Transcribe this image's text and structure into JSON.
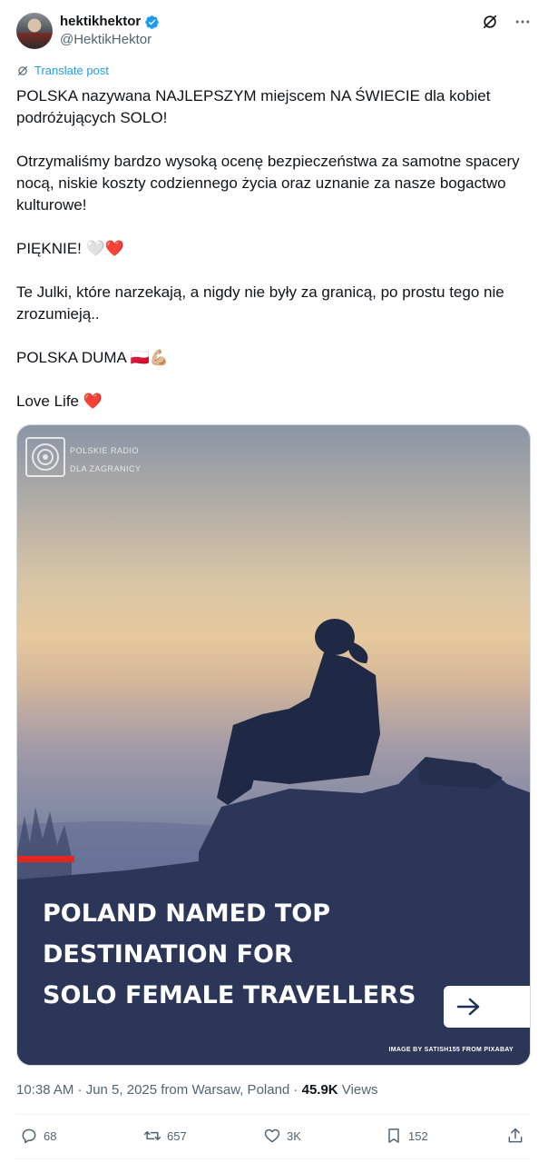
{
  "author": {
    "display_name": "hektikhektor",
    "handle": "@HektikHektor",
    "verified": true
  },
  "header_icons": [
    "grok-icon",
    "more-icon"
  ],
  "translate_label": "Translate post",
  "tweet": {
    "paragraphs": [
      "POLSKA nazywana NAJLEPSZYM miejscem NA ŚWIECIE dla kobiet podróżujących SOLO!",
      "Otrzymaliśmy bardzo wysoką ocenę bezpieczeństwa za samotne spacery nocą, niskie koszty codziennego życia oraz uznanie za nasze bogactwo kulturowe!",
      "PIĘKNIE! 🤍❤️",
      "Te Julki, które narzekają, a nigdy nie były za granicą, po prostu tego nie zrozumieją..",
      "POLSKA DUMA 🇵🇱💪🏼",
      "Love Life ❤️"
    ]
  },
  "media": {
    "logo_line1": "POLSKIE RADIO",
    "logo_line2": "DLA ZAGRANICY",
    "headline_line1": "POLAND NAMED TOP DESTINATION FOR",
    "headline_line2": "SOLO FEMALE TRAVELLERS",
    "credit": "IMAGE BY SATISH155 FROM PIXABAY",
    "accent_color": "#e3261f"
  },
  "meta": {
    "time_date_place": "10:38 AM · Jun 5, 2025 from Warsaw, Poland · ",
    "views_count": "45.9K",
    "views_label": " Views"
  },
  "actions": {
    "replies": "68",
    "reposts": "657",
    "likes": "3K",
    "bookmarks": "152"
  },
  "colors": {
    "link_blue": "#1d9bf0",
    "secondary_text": "#536471",
    "verified_blue": "#1d9bf0"
  }
}
